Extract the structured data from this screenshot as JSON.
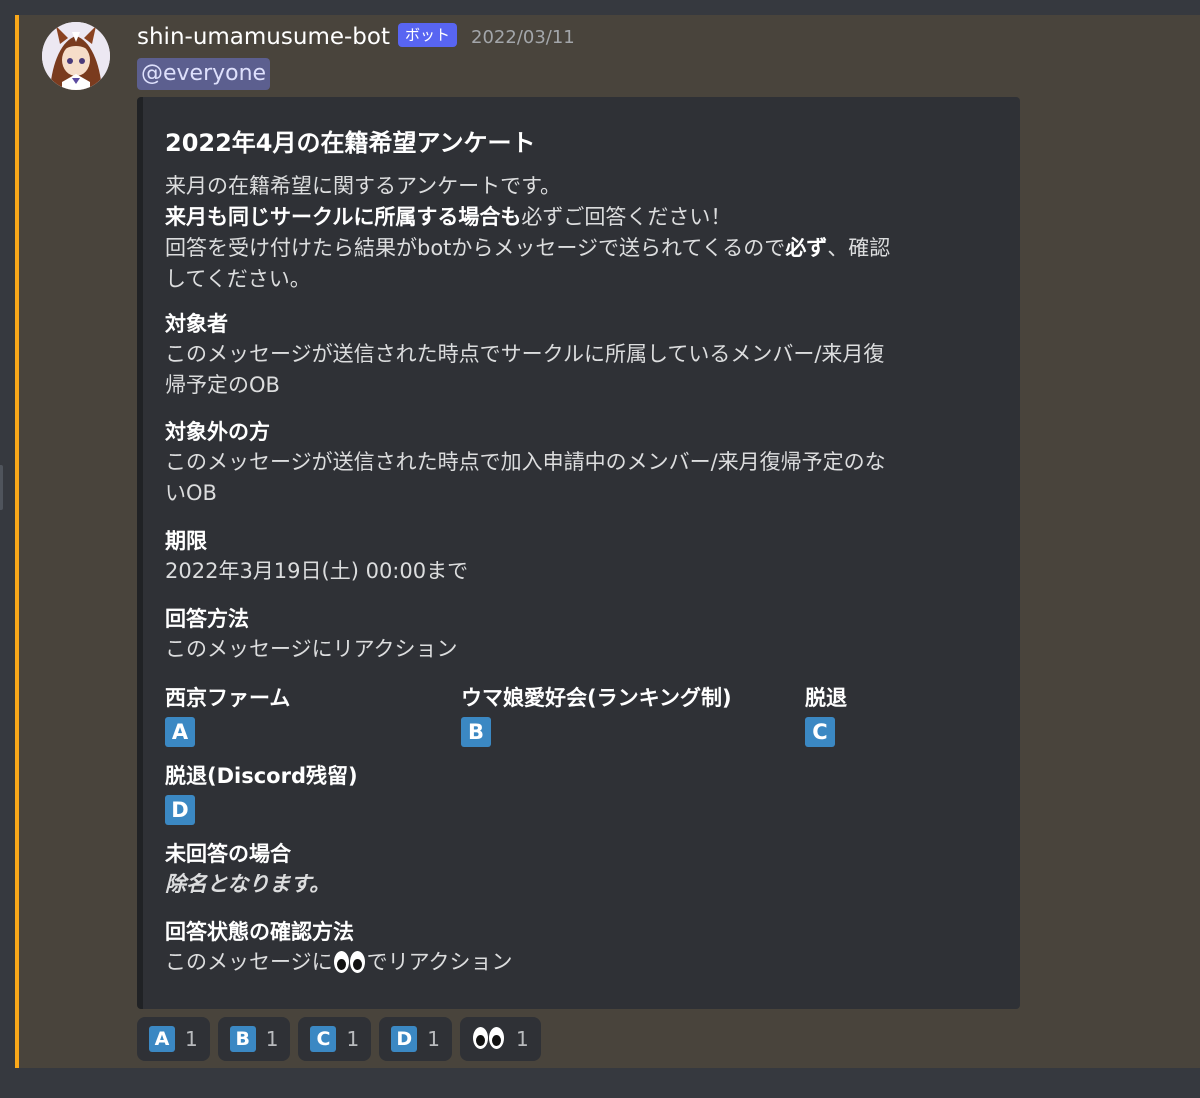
{
  "message": {
    "username": "shin-umamusume-bot",
    "bot_tag": "ボット",
    "timestamp": "2022/03/11",
    "mention": "@everyone"
  },
  "embed": {
    "title": "2022年4月の在籍希望アンケート",
    "description": {
      "line1": "来月の在籍希望に関するアンケートです。",
      "line2_bold": "来月も同じサークルに所属する場合も",
      "line2_rest": "必ずご回答ください！",
      "line3_a": "回答を受け付けたら結果がbotからメッセージで送られてくるので",
      "line3_bold": "必ず",
      "line3_b": "、確認",
      "line4": "してください。"
    },
    "fields": [
      {
        "name": "対象者",
        "lines": [
          "このメッセージが送信された時点でサークルに所属しているメンバー/来月復",
          "帰予定のOB"
        ]
      },
      {
        "name": "対象外の方",
        "lines": [
          "このメッセージが送信された時点で加入申請中のメンバー/来月復帰予定のな",
          "いOB"
        ]
      },
      {
        "name": "期限",
        "lines": [
          "2022年3月19日(土) 00:00まで"
        ]
      },
      {
        "name": "回答方法",
        "lines": [
          "このメッセージにリアクション"
        ]
      }
    ],
    "options": [
      {
        "name": "西京ファーム",
        "letter": "A"
      },
      {
        "name": "ウマ娘愛好会(ランキング制)",
        "letter": "B"
      },
      {
        "name": "脱退",
        "letter": "C"
      },
      {
        "name": "脱退(Discord残留)",
        "letter": "D"
      }
    ],
    "unanswered": {
      "name": "未回答の場合",
      "value": "除名となります。"
    },
    "check": {
      "name": "回答状態の確認方法",
      "value_before": "このメッセージに",
      "value_after": "でリアクション",
      "emoji": "eyes"
    }
  },
  "reactions": [
    {
      "emoji": "A",
      "count": "1"
    },
    {
      "emoji": "B",
      "count": "1"
    },
    {
      "emoji": "C",
      "count": "1"
    },
    {
      "emoji": "D",
      "count": "1"
    },
    {
      "emoji": "eyes",
      "count": "1"
    }
  ],
  "colors": {
    "highlight_bar": "#faa81a",
    "bot_tag": "#5865f2",
    "letter_emoji": "#3b88c3"
  }
}
